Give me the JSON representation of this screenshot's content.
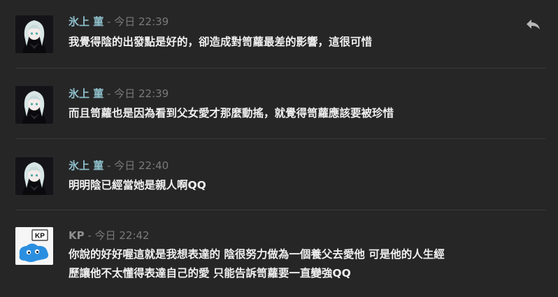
{
  "messages": [
    {
      "author": "氷上 菫",
      "separator": "-",
      "time": "今日 22:39",
      "lines": [
        "我覺得陰的出發點是好的，卻造成對笥蘿最差的影響，這很可惜"
      ]
    },
    {
      "author": "氷上 菫",
      "separator": "-",
      "time": "今日 22:39",
      "lines": [
        "而且笥蘿也是因為看到父女愛才那麼動搖，就覺得笥蘿應該要被珍惜"
      ]
    },
    {
      "author": "氷上 菫",
      "separator": "-",
      "time": "今日 22:40",
      "lines": [
        "明明陰已經當她是親人啊QQ"
      ]
    },
    {
      "author": "KP",
      "separator": "-",
      "time": "今日 22:42",
      "lines": [
        "你說的好好喔這就是我想表達的 陰很努力做為一個養父去愛他 可是他的人生經",
        "歷讓他不太懂得表達自己的愛 只能告訴笥蘿要一直變強QQ"
      ]
    }
  ],
  "icons": {
    "reply": "reply-arrow-icon",
    "avatar_girl": "silver-haired-girl-avatar",
    "avatar_kp": "kp-blue-creature-avatar"
  },
  "kp_avatar_text": "KP",
  "colors": {
    "background": "#262626",
    "author_name": "#8fc0cc",
    "kp_name": "#909090",
    "timestamp": "#7a7a7a",
    "body_text": "#f0f0f0",
    "divider": "#3a3a3a",
    "kp_creature": "#2b8fe0"
  }
}
